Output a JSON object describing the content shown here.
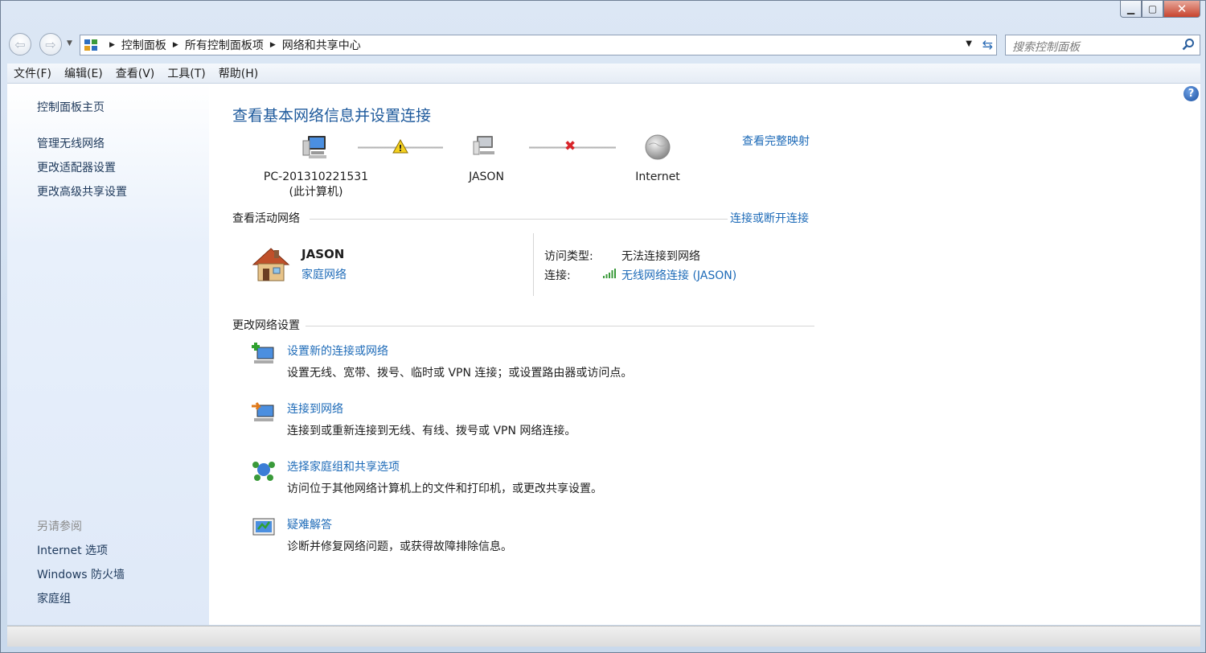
{
  "window": {
    "minimize": "▁",
    "maximize": "▢",
    "close": "✕"
  },
  "nav": {
    "back": "⇦",
    "forward": "⇨",
    "dropdown": "▼",
    "crumb_arrow": "▶",
    "breadcrumbs": [
      "控制面板",
      "所有控制面板项",
      "网络和共享中心"
    ],
    "refresh": "⇆",
    "search_placeholder": "搜索控制面板"
  },
  "menu": [
    "文件(F)",
    "编辑(E)",
    "查看(V)",
    "工具(T)",
    "帮助(H)"
  ],
  "sidebar": {
    "links": [
      "控制面板主页",
      "管理无线网络",
      "更改适配器设置",
      "更改高级共享设置"
    ],
    "see_also_title": "另请参阅",
    "see_also": [
      "Internet 选项",
      "Windows 防火墙",
      "家庭组"
    ]
  },
  "main": {
    "help": "?",
    "title": "查看基本网络信息并设置连接",
    "view_full_map": "查看完整映射",
    "map": {
      "computer_name": "PC-201310221531",
      "computer_sub": "(此计算机)",
      "network_name": "JASON",
      "internet": "Internet",
      "warning_symbol": "!",
      "error_symbol": "✖"
    },
    "active_networks": {
      "heading": "查看活动网络",
      "connect_link": "连接或断开连接",
      "network_name": "JASON",
      "network_type": "家庭网络",
      "access_type_label": "访问类型:",
      "access_type_value": "无法连接到网络",
      "connection_label": "连接:",
      "connection_value": "无线网络连接 (JASON)"
    },
    "change_settings": {
      "heading": "更改网络设置",
      "tasks": [
        {
          "title": "设置新的连接或网络",
          "desc": "设置无线、宽带、拨号、临时或 VPN 连接；或设置路由器或访问点。"
        },
        {
          "title": "连接到网络",
          "desc": "连接到或重新连接到无线、有线、拨号或 VPN 网络连接。"
        },
        {
          "title": "选择家庭组和共享选项",
          "desc": "访问位于其他网络计算机上的文件和打印机，或更改共享设置。"
        },
        {
          "title": "疑难解答",
          "desc": "诊断并修复网络问题，或获得故障排除信息。"
        }
      ]
    }
  },
  "colors": {
    "link": "#1e6bb8",
    "title": "#1e5a9c",
    "close_button": "#c7442e"
  }
}
